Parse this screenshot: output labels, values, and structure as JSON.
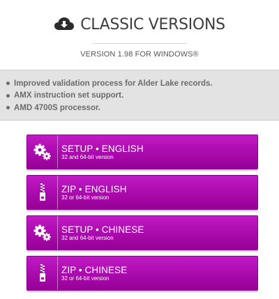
{
  "header": {
    "title": "CLASSIC VERSIONS",
    "icon": "cloud-download-icon"
  },
  "version": "VERSION 1.98 FOR WINDOWS®",
  "notes": [
    "Improved validation process for Alder Lake records.",
    "AMX instruction set support.",
    "AMD 4700S processor."
  ],
  "buttons": [
    {
      "label": "SETUP • ENGLISH",
      "sublabel": "32 and 64-bit version",
      "icon": "gears-icon"
    },
    {
      "label": "ZIP • ENGLISH",
      "sublabel": "32 or 64-bit version",
      "icon": "zip-file-icon"
    },
    {
      "label": "SETUP • CHINESE",
      "sublabel": "32 and 64-bit version",
      "icon": "gears-icon"
    },
    {
      "label": "ZIP • CHINESE",
      "sublabel": "32 or 64-bit version",
      "icon": "zip-file-icon"
    }
  ],
  "colors": {
    "button_top": "#c01ac6",
    "button_bottom": "#960096",
    "notes_bg": "#e3e3e3"
  }
}
